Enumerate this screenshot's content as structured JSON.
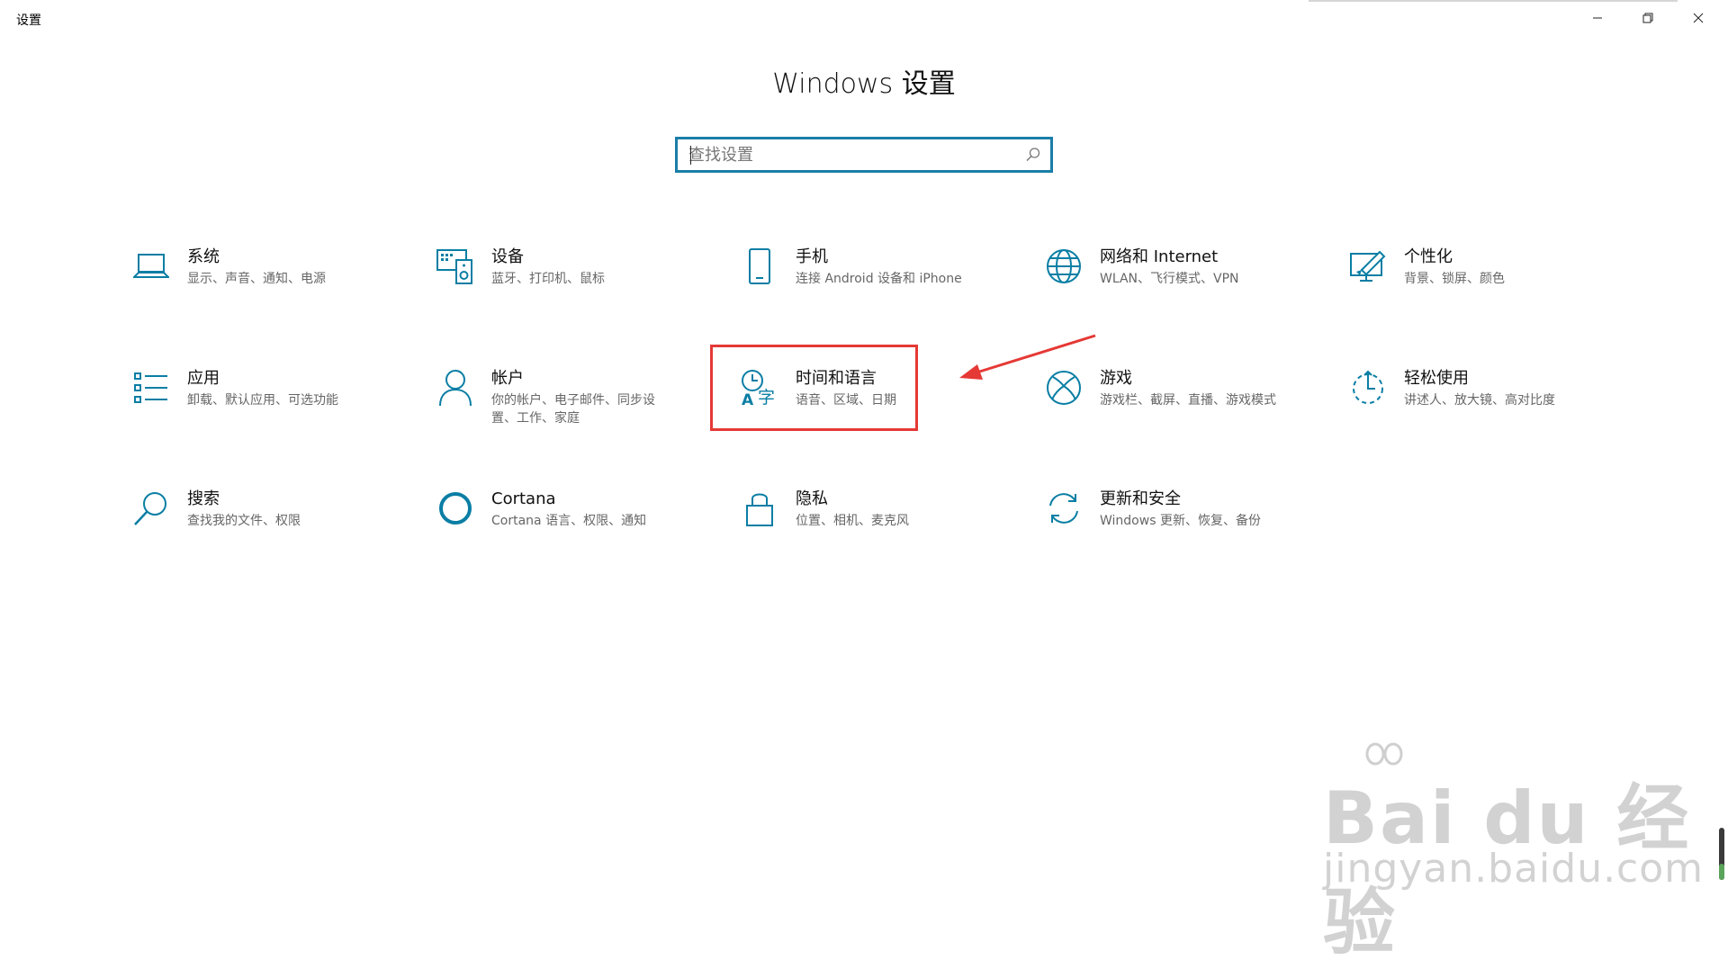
{
  "window": {
    "title": "设置"
  },
  "header": {
    "title": "Windows 设置"
  },
  "search": {
    "placeholder": "查找设置"
  },
  "tiles": [
    {
      "name": "系统",
      "desc": "显示、声音、通知、电源",
      "icon": "laptop-icon"
    },
    {
      "name": "设备",
      "desc": "蓝牙、打印机、鼠标",
      "icon": "devices-icon"
    },
    {
      "name": "手机",
      "desc": "连接 Android 设备和 iPhone",
      "icon": "phone-icon"
    },
    {
      "name": "网络和 Internet",
      "desc": "WLAN、飞行模式、VPN",
      "icon": "globe-icon"
    },
    {
      "name": "个性化",
      "desc": "背景、锁屏、颜色",
      "icon": "personalization-icon"
    },
    {
      "name": "应用",
      "desc": "卸载、默认应用、可选功能",
      "icon": "apps-list-icon"
    },
    {
      "name": "帐户",
      "desc": "你的帐户、电子邮件、同步设置、工作、家庭",
      "icon": "person-icon"
    },
    {
      "name": "时间和语言",
      "desc": "语音、区域、日期",
      "icon": "time-language-icon"
    },
    {
      "name": "游戏",
      "desc": "游戏栏、截屏、直播、游戏模式",
      "icon": "xbox-icon"
    },
    {
      "name": "轻松使用",
      "desc": "讲述人、放大镜、高对比度",
      "icon": "ease-of-access-icon"
    },
    {
      "name": "搜索",
      "desc": "查找我的文件、权限",
      "icon": "search-icon"
    },
    {
      "name": "Cortana",
      "desc": "Cortana 语言、权限、通知",
      "icon": "cortana-icon"
    },
    {
      "name": "隐私",
      "desc": "位置、相机、麦克风",
      "icon": "lock-icon"
    },
    {
      "name": "更新和安全",
      "desc": "Windows 更新、恢复、备份",
      "icon": "sync-icon"
    }
  ],
  "watermark": {
    "brand": "Bai du 经验",
    "url": "jingyan.baidu.com"
  },
  "colors": {
    "accent": "#0a7ea4",
    "highlight": "#e53935"
  }
}
